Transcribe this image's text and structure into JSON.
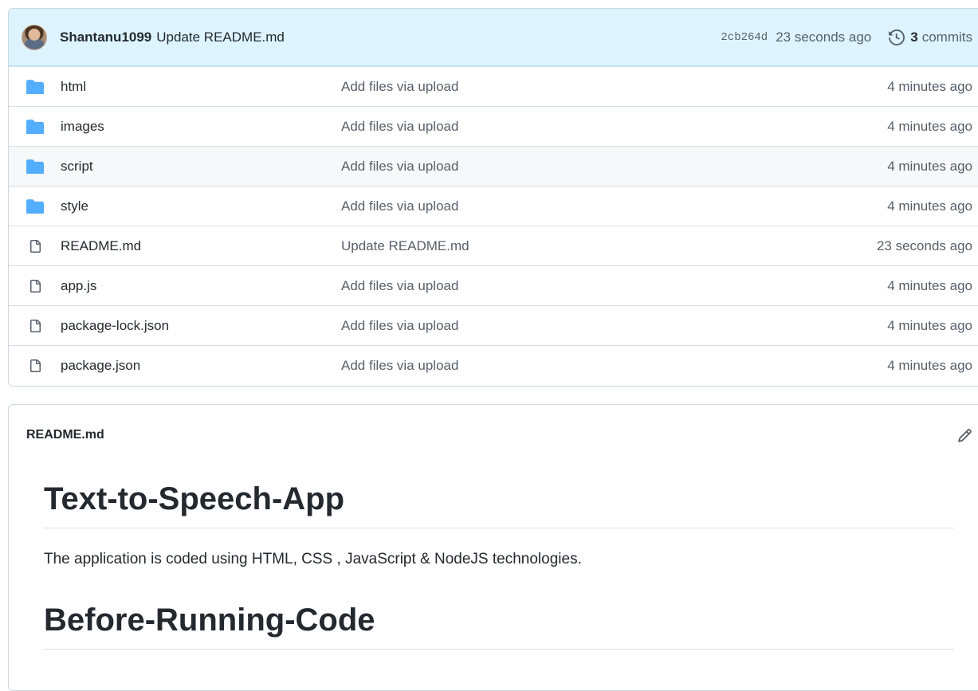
{
  "commit": {
    "author": "Shantanu1099",
    "message": "Update README.md",
    "sha": "2cb264d",
    "time": "23 seconds ago",
    "count": "3",
    "count_label": "commits"
  },
  "files": [
    {
      "name": "html",
      "type": "folder",
      "message": "Add files via upload",
      "age": "4 minutes ago"
    },
    {
      "name": "images",
      "type": "folder",
      "message": "Add files via upload",
      "age": "4 minutes ago"
    },
    {
      "name": "script",
      "type": "folder",
      "message": "Add files via upload",
      "age": "4 minutes ago"
    },
    {
      "name": "style",
      "type": "folder",
      "message": "Add files via upload",
      "age": "4 minutes ago"
    },
    {
      "name": "README.md",
      "type": "file",
      "message": "Update README.md",
      "age": "23 seconds ago"
    },
    {
      "name": "app.js",
      "type": "file",
      "message": "Add files via upload",
      "age": "4 minutes ago"
    },
    {
      "name": "package-lock.json",
      "type": "file",
      "message": "Add files via upload",
      "age": "4 minutes ago"
    },
    {
      "name": "package.json",
      "type": "file",
      "message": "Add files via upload",
      "age": "4 minutes ago"
    }
  ],
  "readme": {
    "filename": "README.md",
    "heading1": "Text-to-Speech-App",
    "paragraph": "The application is coded using HTML, CSS , JavaScript & NodeJS technologies.",
    "heading2": "Before-Running-Code"
  },
  "colors": {
    "folder": "#54aeff",
    "commit_bar": "#ddf4ff",
    "muted_text": "#57606a",
    "border": "#d0d7de"
  },
  "icons": {
    "folder": "folder-icon",
    "file": "file-icon",
    "history": "history-icon",
    "edit": "pencil-icon"
  }
}
